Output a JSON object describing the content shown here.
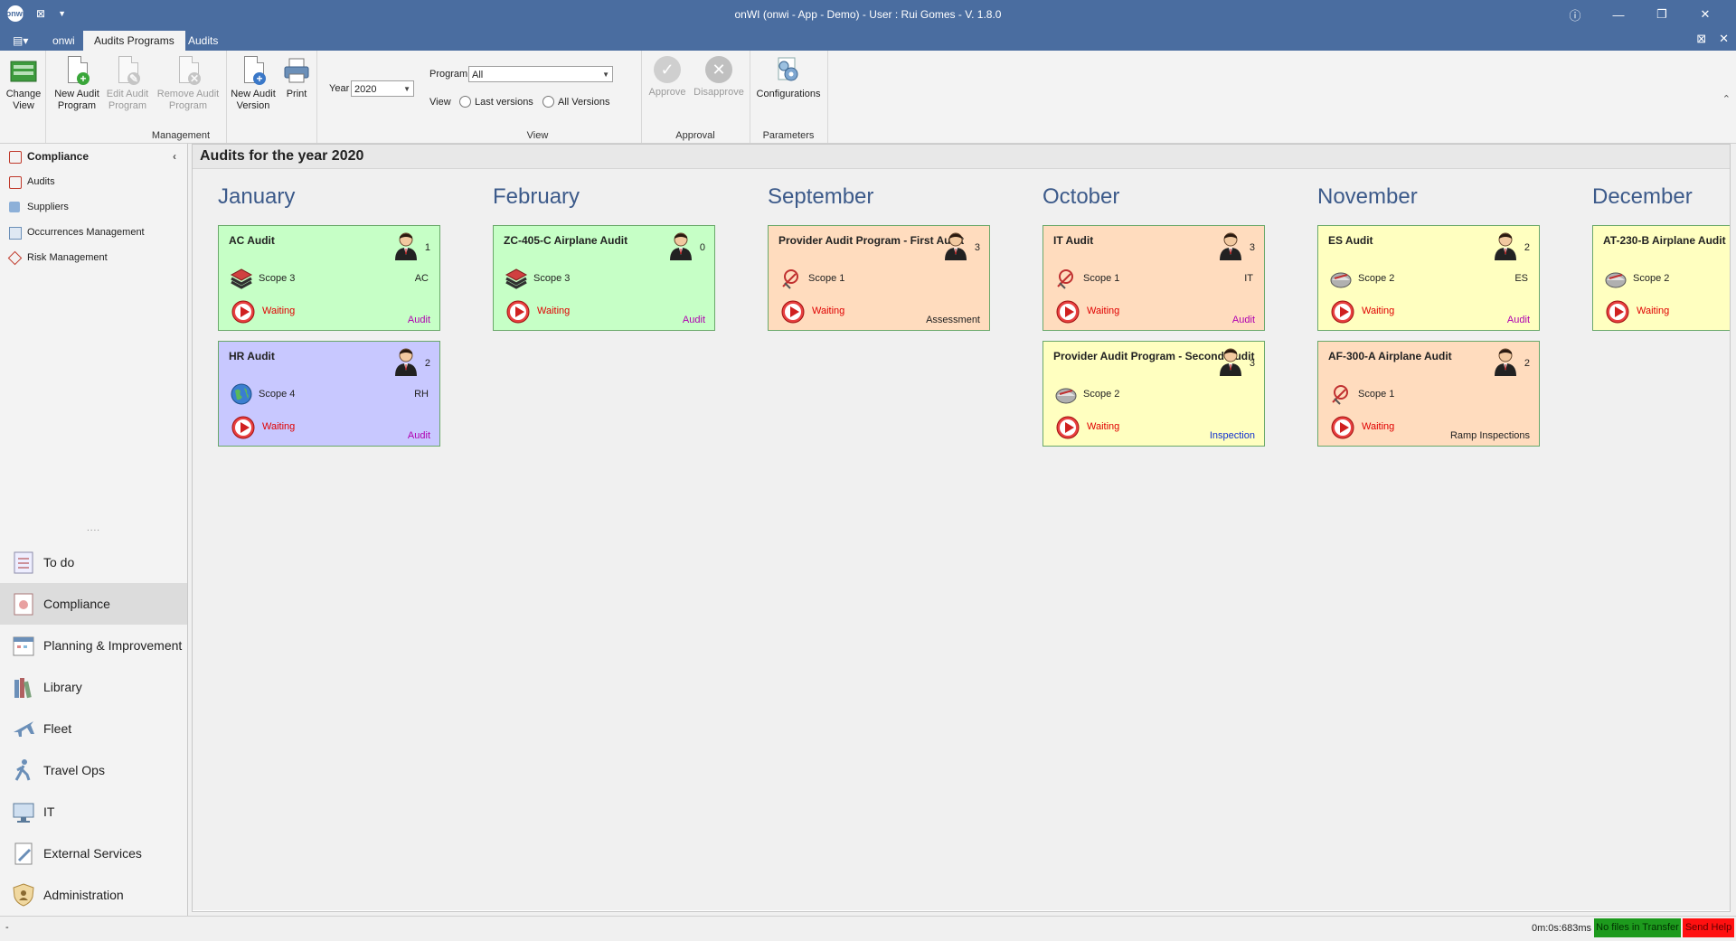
{
  "titlebar": {
    "title": "onWI (onwi - App - Demo) - User : Rui Gomes - V. 1.8.0",
    "logo_text": "onwi"
  },
  "tabs": [
    {
      "label": "onwi"
    },
    {
      "label": "Audits Programs"
    },
    {
      "label": "Audits"
    }
  ],
  "ribbon": {
    "change_view": "Change View",
    "new_audit_program": "New Audit Program",
    "edit_audit_program": "Edit Audit Program",
    "remove_audit_program": "Remove Audit Program",
    "new_audit_version": "New Audit Version",
    "print": "Print",
    "management": "Management",
    "year_label": "Year",
    "year_value": "2020",
    "program_label": "Program",
    "program_value": "All",
    "view_label": "View",
    "last_versions": "Last versions",
    "all_versions": "All Versions",
    "view_group": "View",
    "approve": "Approve",
    "disapprove": "Disapprove",
    "approval_group": "Approval",
    "configurations": "Configurations",
    "parameters_group": "Parameters"
  },
  "sidebar": {
    "header": "Compliance",
    "items": [
      {
        "label": "Audits",
        "icon": "audits-icon"
      },
      {
        "label": "Suppliers",
        "icon": "suppliers-icon"
      },
      {
        "label": "Occurrences Management",
        "icon": "occurrences-icon"
      },
      {
        "label": "Risk Management",
        "icon": "risk-icon"
      }
    ],
    "splitter": "....",
    "modules": [
      {
        "label": "To do",
        "icon": "todo-icon"
      },
      {
        "label": "Compliance",
        "icon": "compliance-icon"
      },
      {
        "label": "Planning & Improvement",
        "icon": "planning-icon"
      },
      {
        "label": "Library",
        "icon": "library-icon"
      },
      {
        "label": "Fleet",
        "icon": "fleet-icon"
      },
      {
        "label": "Travel Ops",
        "icon": "travel-ops-icon"
      },
      {
        "label": "IT",
        "icon": "it-icon"
      },
      {
        "label": "External Services",
        "icon": "external-services-icon"
      },
      {
        "label": "Administration",
        "icon": "administration-icon"
      }
    ]
  },
  "main": {
    "heading": "Audits for the year 2020",
    "months": [
      {
        "name": "January",
        "cards": [
          {
            "title": "AC Audit",
            "count": "1",
            "scope": "Scope 3",
            "code": "AC",
            "status": "Waiting",
            "kind": "Audit",
            "color": "#c6ffc6",
            "scope_icon": "layers-icon"
          },
          {
            "title": "HR Audit",
            "count": "2",
            "scope": "Scope 4",
            "code": "RH",
            "status": "Waiting",
            "kind": "Audit",
            "color": "#c8c8ff",
            "scope_icon": "globe-icon"
          }
        ]
      },
      {
        "name": "February",
        "cards": [
          {
            "title": "ZC-405-C Airplane Audit",
            "count": "0",
            "scope": "Scope 3",
            "code": "",
            "status": "Waiting",
            "kind": "Audit",
            "color": "#c6ffc6",
            "scope_icon": "layers-icon"
          }
        ]
      },
      {
        "name": "September",
        "cards": [
          {
            "title": "Provider Audit Program - First Audit",
            "count": "3",
            "scope": "Scope 1",
            "code": "",
            "status": "Waiting",
            "kind": "Assessment",
            "color": "#ffdcbe",
            "scope_icon": "tools-icon"
          }
        ]
      },
      {
        "name": "October",
        "cards": [
          {
            "title": "IT Audit",
            "count": "3",
            "scope": "Scope 1",
            "code": "IT",
            "status": "Waiting",
            "kind": "Audit",
            "color": "#ffdcbe",
            "scope_icon": "tools-icon"
          },
          {
            "title": "Provider Audit Program - Second Audit",
            "count": "3",
            "scope": "Scope 2",
            "code": "",
            "status": "Waiting",
            "kind": "Inspection",
            "color": "#ffffc0",
            "scope_icon": "ball-icon"
          }
        ]
      },
      {
        "name": "November",
        "cards": [
          {
            "title": "ES Audit",
            "count": "2",
            "scope": "Scope 2",
            "code": "ES",
            "status": "Waiting",
            "kind": "Audit",
            "color": "#ffffc0",
            "scope_icon": "ball-icon"
          },
          {
            "title": "AF-300-A Airplane Audit",
            "count": "2",
            "scope": "Scope 1",
            "code": "",
            "status": "Waiting",
            "kind": "Ramp Inspections",
            "color": "#ffdcbe",
            "scope_icon": "tools-icon"
          }
        ]
      },
      {
        "name": "December",
        "cards": [
          {
            "title": "AT-230-B Airplane Audit",
            "count": "",
            "scope": "Scope 2",
            "code": "",
            "status": "Waiting",
            "kind": "",
            "color": "#ffffc0",
            "scope_icon": "ball-icon"
          }
        ]
      }
    ]
  },
  "statusbar": {
    "left": "-",
    "time": "0m:0s:683ms",
    "transfer": "No files in Transfer",
    "help": "Send Help"
  },
  "colors": {
    "titlebar": "#4a6da0",
    "month_heading": "#3c5a8a",
    "status_waiting": "#e00000",
    "kind_audit": "#b000b0",
    "kind_inspection": "#1030d0"
  }
}
